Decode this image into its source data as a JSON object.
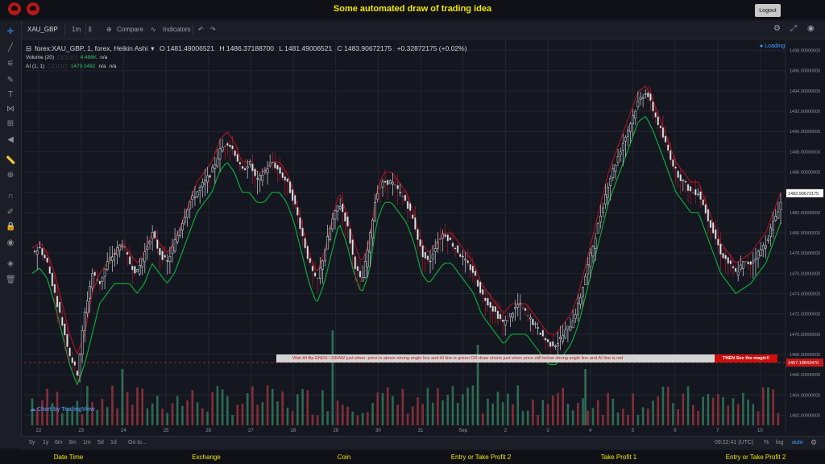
{
  "app": {
    "title": "Some automated draw of trading idea",
    "logout_label": "Logout"
  },
  "toolbar": {
    "symbol": "XAU_GBP",
    "interval": "1m",
    "compare_label": "Compare",
    "indicators_label": "Indicators"
  },
  "legend": {
    "main": "forex:XAU_GBP, 1, forex, Heikin Ashi",
    "open": "O 1481.49006521",
    "high": "H 1486.37188700",
    "low": "L 1481.49006521",
    "close": "C 1483.90672175",
    "change": "+0.32872175 (+0.02%)",
    "volume_label": "Volume (20)",
    "volume_value": "4.486K",
    "volume_na": "n/a",
    "ai_label": "AI (1, 1)",
    "ai_value": "1479.0492",
    "ai_na1": "n/a",
    "ai_na2": "n/a"
  },
  "status": {
    "loading": "Loading"
  },
  "price_axis": {
    "ticks": [
      "1498.00000000",
      "1496.00000000",
      "1494.00000000",
      "1492.00000000",
      "1490.00000000",
      "1488.00000000",
      "1486.00000000",
      "1484.00000000",
      "1482.00000000",
      "1480.00000000",
      "1478.00000000",
      "1476.00000000",
      "1474.00000000",
      "1472.00000000",
      "1470.00000000",
      "1468.00000000",
      "1466.00000000",
      "1464.00000000",
      "1462.00000000"
    ],
    "current_price": "1483.90672175",
    "dashed_level": "1467.18843470"
  },
  "time_axis": {
    "labels": [
      "22",
      "23",
      "24",
      "25",
      "26",
      "27",
      "28",
      "29",
      "30",
      "31",
      "Sep",
      "2",
      "3",
      "4",
      "5",
      "6",
      "7",
      "10"
    ]
  },
  "banner": {
    "text": "Wait till flip ENDS  !   DRAW just when:  price is above strong angle line and AI line is green        OR        draw shorts just when price still below strong angle line and AI line is red",
    "end_text": "THEN See the magic!!"
  },
  "watermark": "Chart by TradingView",
  "bottombar": {
    "ranges": [
      "5y",
      "1y",
      "6m",
      "3m",
      "1m",
      "5d",
      "1d"
    ],
    "goto": "Go to...",
    "time": "09:22:41 (UTC)",
    "percent": "%",
    "log": "log",
    "auto": "auto"
  },
  "nav": {
    "items": [
      "Date Time",
      "Exchange",
      "Coin",
      "Entry or Take Profit 2",
      "Take Profit 1",
      "Entry or Take Profit 2"
    ]
  },
  "colors": {
    "up_volume": "#2f6f55",
    "down_volume": "#8b2f3a",
    "strong_line": "#b01522",
    "ai_line": "#0fa83a",
    "price_label": "#ffffff"
  },
  "chart_data": {
    "type": "candlestick",
    "chart_style": "Heikin Ashi",
    "ylim": [
      1461,
      1499
    ],
    "x": [
      "22",
      "23",
      "24",
      "25",
      "26",
      "27",
      "28",
      "29",
      "30",
      "31",
      "Sep",
      "2",
      "3",
      "4",
      "5",
      "6",
      "7",
      "10"
    ],
    "close_path": [
      1478,
      1478.5,
      1477,
      1474,
      1471,
      1468,
      1466,
      1472,
      1476,
      1475,
      1477,
      1478,
      1479,
      1477,
      1476,
      1478,
      1480,
      1478,
      1477,
      1479,
      1481,
      1483,
      1484,
      1485,
      1486,
      1488,
      1489,
      1488,
      1486,
      1487,
      1485,
      1486,
      1487,
      1486,
      1485,
      1483,
      1480,
      1477,
      1475,
      1478,
      1481,
      1483,
      1481,
      1477,
      1475,
      1479,
      1484,
      1485,
      1485,
      1484,
      1483,
      1481,
      1478,
      1477,
      1479,
      1480,
      1479,
      1478,
      1477,
      1476,
      1474,
      1473,
      1472,
      1471,
      1472,
      1473,
      1472,
      1471,
      1470,
      1469,
      1469,
      1470,
      1471,
      1473,
      1476,
      1479,
      1482,
      1485,
      1487,
      1489,
      1491,
      1493,
      1494,
      1492,
      1490,
      1488,
      1486,
      1485,
      1484,
      1484,
      1482,
      1480,
      1478,
      1477,
      1476,
      1477,
      1477,
      1478,
      1479,
      1481,
      1483
    ],
    "strong_line": [
      1478.5,
      1479,
      1478,
      1476,
      1473,
      1470,
      1468,
      1470,
      1474,
      1476,
      1477,
      1478,
      1479,
      1478,
      1477,
      1478,
      1480,
      1479,
      1478,
      1479,
      1481,
      1483,
      1485,
      1486,
      1487,
      1489,
      1490,
      1489,
      1487,
      1487,
      1486,
      1486,
      1487,
      1487,
      1486,
      1484,
      1481,
      1478,
      1476,
      1478,
      1481,
      1484,
      1482,
      1479,
      1477,
      1479,
      1484,
      1486,
      1486,
      1485,
      1484,
      1482,
      1479,
      1478,
      1479,
      1480,
      1480,
      1479,
      1478,
      1477,
      1475,
      1474,
      1473,
      1472,
      1473,
      1473,
      1473,
      1472,
      1471,
      1470,
      1470,
      1471,
      1472,
      1474,
      1477,
      1480,
      1483,
      1486,
      1488,
      1490,
      1492,
      1494,
      1494.5,
      1493,
      1491,
      1489,
      1487,
      1486,
      1485,
      1485,
      1483,
      1481,
      1479,
      1478,
      1477,
      1477.5,
      1478,
      1479,
      1480,
      1482,
      1484
    ],
    "ai_line": [
      1476,
      1476.5,
      1475.5,
      1473,
      1470,
      1467,
      1465,
      1467,
      1470,
      1473,
      1474,
      1475,
      1475,
      1475,
      1474,
      1475,
      1477,
      1476,
      1475,
      1476,
      1478,
      1480,
      1482,
      1483,
      1484,
      1486,
      1487,
      1486,
      1484,
      1484,
      1483,
      1483,
      1484,
      1484,
      1483,
      1481,
      1478,
      1475,
      1473,
      1475,
      1478,
      1481,
      1479,
      1476,
      1474,
      1476,
      1481,
      1483,
      1483,
      1482,
      1481,
      1479,
      1476,
      1475,
      1476,
      1477,
      1477,
      1476,
      1475,
      1474,
      1472,
      1471,
      1470,
      1469,
      1470,
      1470,
      1470,
      1469,
      1468,
      1467,
      1467,
      1468,
      1469,
      1471,
      1474,
      1477,
      1480,
      1483,
      1485,
      1487,
      1489,
      1491,
      1491.5,
      1490,
      1488,
      1486,
      1484,
      1483,
      1482,
      1482,
      1480,
      1478,
      1476,
      1475,
      1474,
      1474.5,
      1475,
      1476,
      1477,
      1479,
      1481
    ]
  }
}
